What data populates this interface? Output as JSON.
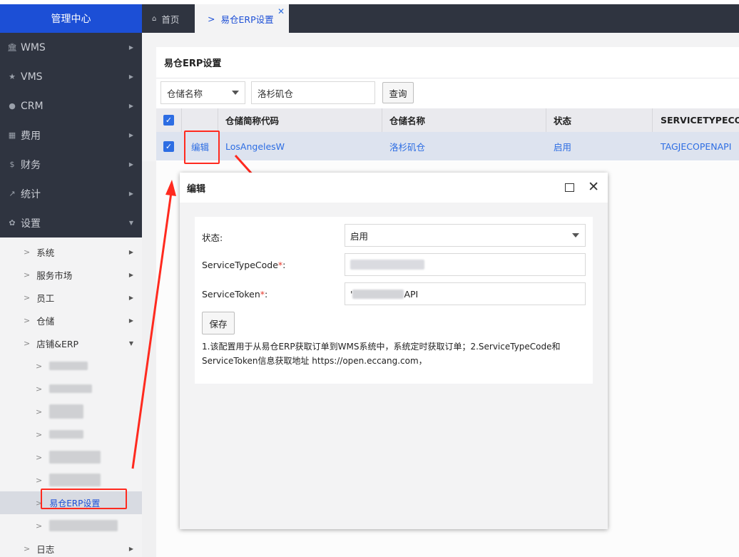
{
  "sidebar": {
    "title": "管理中心",
    "menu": [
      {
        "icon": "bank-icon",
        "glyph": "🏛",
        "label": "WMS"
      },
      {
        "icon": "star-icon",
        "glyph": "★",
        "label": "VMS"
      },
      {
        "icon": "user-icon",
        "glyph": "●",
        "label": "CRM"
      },
      {
        "icon": "grid-icon",
        "glyph": "▦",
        "label": "费用"
      },
      {
        "icon": "dollar-icon",
        "glyph": "$",
        "label": "财务"
      },
      {
        "icon": "chart-icon",
        "glyph": "↗",
        "label": "统计"
      },
      {
        "icon": "gear-icon",
        "glyph": "✿",
        "label": "设置"
      }
    ],
    "sub": [
      "系统",
      "服务市场",
      "员工",
      "仓储",
      "店铺&ERP"
    ],
    "active_leaf": "易仓ERP设置",
    "last": "日志"
  },
  "tabs": {
    "home": "首页",
    "active": "易仓ERP设置"
  },
  "page": {
    "title": "易仓ERP设置",
    "filter_select": "仓储名称",
    "filter_value": "洛杉矶仓",
    "query_button": "查询"
  },
  "table": {
    "headers": [
      "仓储简称代码",
      "仓储名称",
      "状态",
      "SERVICETYPECO"
    ],
    "row": {
      "action": "编辑",
      "code": "LosAngelesW",
      "name": "洛杉矶仓",
      "status": "启用",
      "servicetype": "TAGJECOPENAPI"
    }
  },
  "modal": {
    "title": "编辑",
    "status_label": "状态:",
    "status_value": "启用",
    "stc_label": "ServiceTypeCode",
    "stc_suffix": ":",
    "token_label": "ServiceToken",
    "token_suffix": ":",
    "token_value_prefix": "'",
    "token_value_suffix": "API",
    "required_mark": "*",
    "save": "保存",
    "note": "1.该配置用于从易仓ERP获取订单到WMS系统中，系统定时获取订单；2.ServiceTypeCode和ServiceToken信息获取地址 https://open.eccang.com，"
  },
  "colors": {
    "accent": "#1c4fd6",
    "dark": "#2f3440",
    "annotation": "#ff2a1f"
  }
}
